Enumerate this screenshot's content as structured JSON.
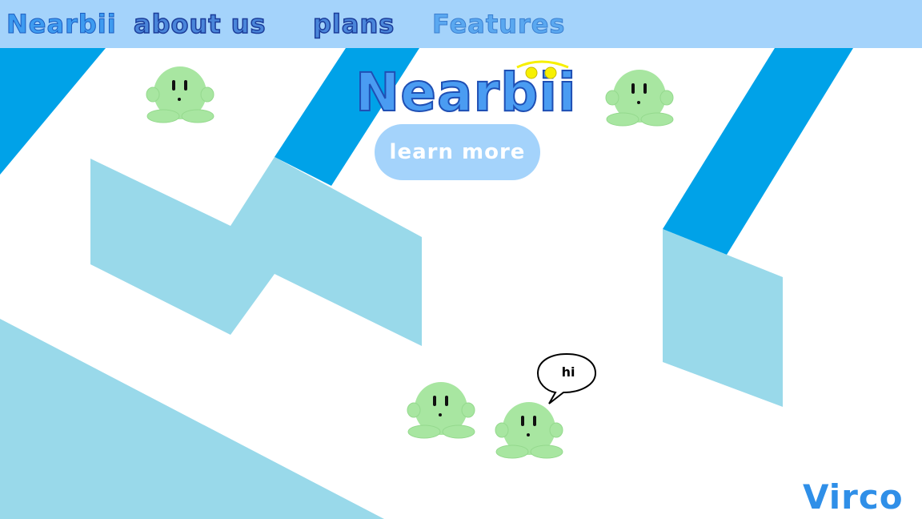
{
  "nav": {
    "brand": "Nearbii",
    "items": [
      {
        "label": "about us"
      },
      {
        "label": "plans"
      },
      {
        "label": "Features"
      }
    ]
  },
  "hero": {
    "logo_text": "Nearbii",
    "cta_label": "learn more"
  },
  "speech_bubble": {
    "text": "hi"
  },
  "signature": "Virco",
  "colors": {
    "nav_bar": "#a4d3fb",
    "accent_blue": "#00a2e8",
    "light_blue": "#99d9ea",
    "blob_green": "#a8e6a1",
    "logo_dot_yellow": "#f7f000"
  },
  "icons": [
    "blob-character",
    "speech-bubble",
    "smile-arc"
  ]
}
